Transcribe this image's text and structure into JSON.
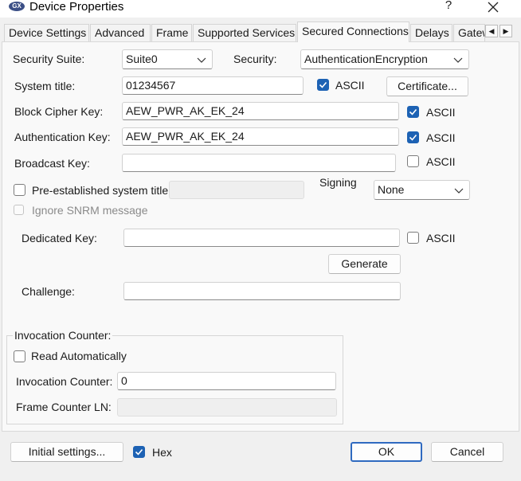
{
  "window": {
    "title": "Device Properties",
    "icon_text": "GX",
    "help": "?",
    "close": "✕"
  },
  "tabs": [
    {
      "label": "Device Settings"
    },
    {
      "label": "Advanced"
    },
    {
      "label": "Frame"
    },
    {
      "label": "Supported Services"
    },
    {
      "label": "Secured Connections"
    },
    {
      "label": "Delays"
    },
    {
      "label": "Gateway"
    }
  ],
  "tab_scroll": {
    "left": "◀",
    "right": "▶"
  },
  "form": {
    "security_suite": {
      "label": "Security Suite:",
      "value": "Suite0"
    },
    "security": {
      "label": "Security:",
      "value": "AuthenticationEncryption"
    },
    "system_title": {
      "label": "System title:",
      "value": "01234567",
      "ascii_label": "ASCII",
      "ascii_checked": true
    },
    "certificate_button": "Certificate...",
    "block_cipher_key": {
      "label": "Block Cipher Key:",
      "value": "AEW_PWR_AK_EK_24",
      "ascii_label": "ASCII",
      "ascii_checked": true
    },
    "authentication_key": {
      "label": "Authentication Key:",
      "value": "AEW_PWR_AK_EK_24",
      "ascii_label": "ASCII",
      "ascii_checked": true
    },
    "broadcast_key": {
      "label": "Broadcast Key:",
      "value": "",
      "ascii_label": "ASCII",
      "ascii_checked": false
    },
    "pre_established": {
      "label": "Pre-established system title:",
      "checked": false,
      "value": ""
    },
    "signing": {
      "label": "Signing",
      "value": "None"
    },
    "ignore_snrm": {
      "label": "Ignore SNRM message",
      "checked": false,
      "disabled": true
    },
    "dedicated_key": {
      "label": "Dedicated Key:",
      "value": "",
      "ascii_label": "ASCII",
      "ascii_checked": false
    },
    "generate_button": "Generate",
    "challenge": {
      "label": "Challenge:",
      "value": ""
    }
  },
  "invocation_group": {
    "title": "Invocation Counter:",
    "read_automatically": {
      "label": "Read Automatically",
      "checked": false
    },
    "invocation_counter": {
      "label": "Invocation Counter:",
      "value": "0"
    },
    "frame_counter_ln": {
      "label": "Frame Counter LN:",
      "value": ""
    }
  },
  "footer": {
    "initial_settings": "Initial settings...",
    "hex_label": "Hex",
    "hex_checked": true,
    "ok": "OK",
    "cancel": "Cancel"
  },
  "colors": {
    "accent": "#1d62b4",
    "default_button_border": "#2f6ac0",
    "panel": "#f9f9f9",
    "chrome": "#f0f0f0"
  }
}
